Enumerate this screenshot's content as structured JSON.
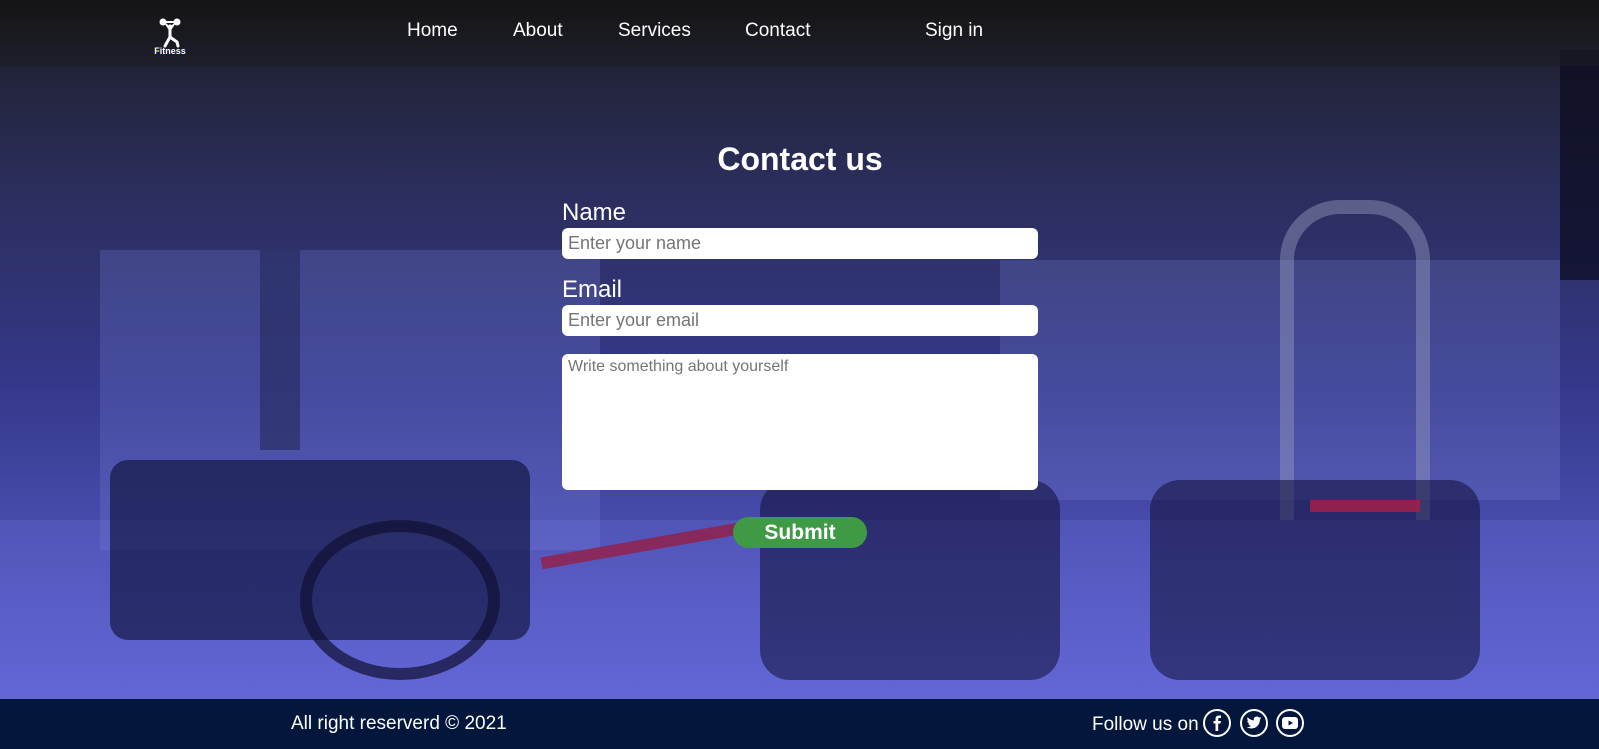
{
  "nav": {
    "logo_text": "Fitness",
    "links": [
      "Home",
      "About",
      "Services",
      "Contact",
      "Sign in"
    ]
  },
  "contact": {
    "title": "Contact us",
    "name_label": "Name",
    "name_placeholder": "Enter your name",
    "email_label": "Email",
    "email_placeholder": "Enter your email",
    "message_placeholder": "Write something about yourself",
    "submit_label": "Submit"
  },
  "footer": {
    "copyright": "All right reserverd © 2021",
    "follow_label": "Follow us on",
    "social_icons": [
      "facebook-icon",
      "twitter-icon",
      "youtube-icon"
    ]
  },
  "colors": {
    "submit": "#3f9a45",
    "footer": "#03163b",
    "overlay": "#35388a"
  }
}
